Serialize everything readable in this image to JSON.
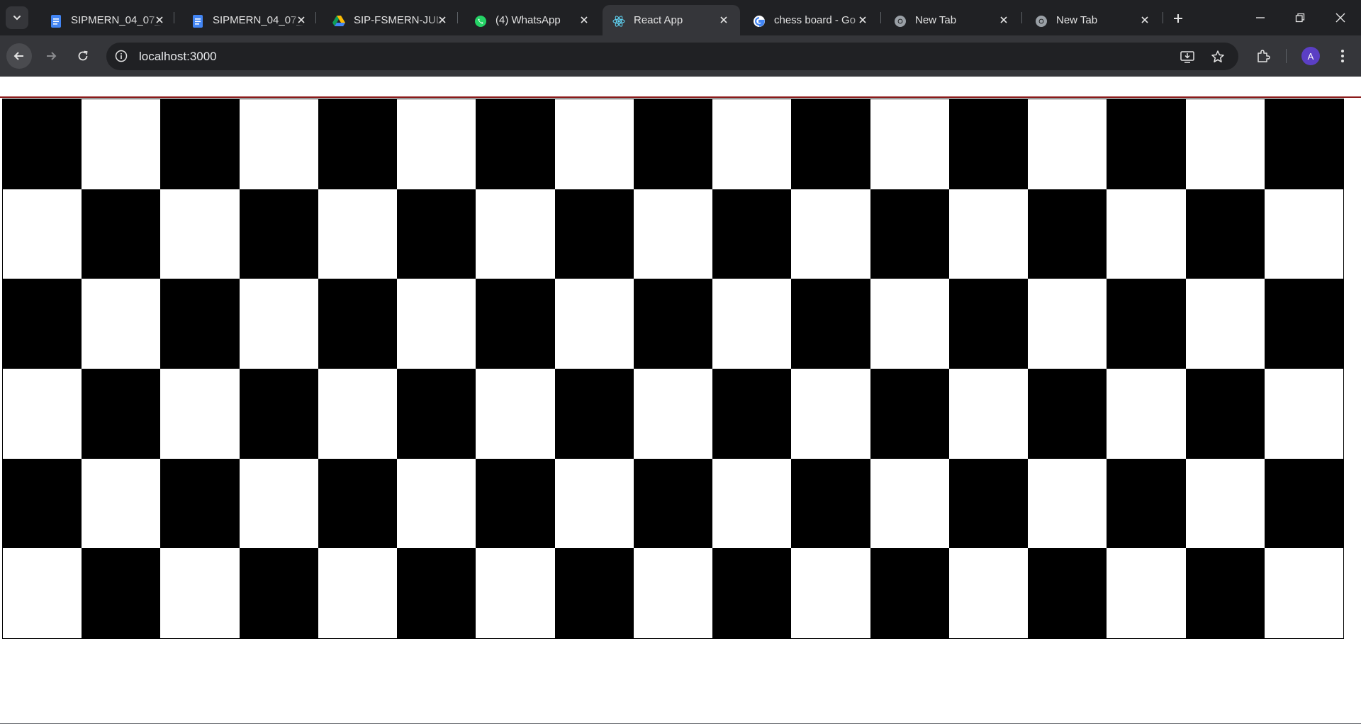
{
  "browser": {
    "tabs": [
      {
        "title": "SIPMERN_04_07_",
        "icon": "google-docs-icon",
        "active": false
      },
      {
        "title": "SIPMERN_04_07_",
        "icon": "google-docs-icon",
        "active": false
      },
      {
        "title": "SIP-FSMERN-JUL",
        "icon": "google-drive-icon",
        "active": false
      },
      {
        "title": "(4) WhatsApp",
        "icon": "whatsapp-icon",
        "active": false
      },
      {
        "title": "React App",
        "icon": "react-icon",
        "active": true
      },
      {
        "title": "chess board - Go",
        "icon": "google-icon",
        "active": false
      },
      {
        "title": "New Tab",
        "icon": "chrome-icon",
        "active": false
      },
      {
        "title": "New Tab",
        "icon": "chrome-icon",
        "active": false
      }
    ],
    "address_bar": {
      "url": "localhost:3000"
    },
    "profile_initial": "A"
  },
  "colors": {
    "chrome_dark": "#202124",
    "chrome_toolbar": "#35363a",
    "board_dark": "#000000",
    "board_light": "#ffffff",
    "accent_line": "#8b1a1a",
    "avatar": "#5b3fc4"
  },
  "page": {
    "board": {
      "rows": 6,
      "columns": 17,
      "top_left_color": "dark"
    }
  }
}
